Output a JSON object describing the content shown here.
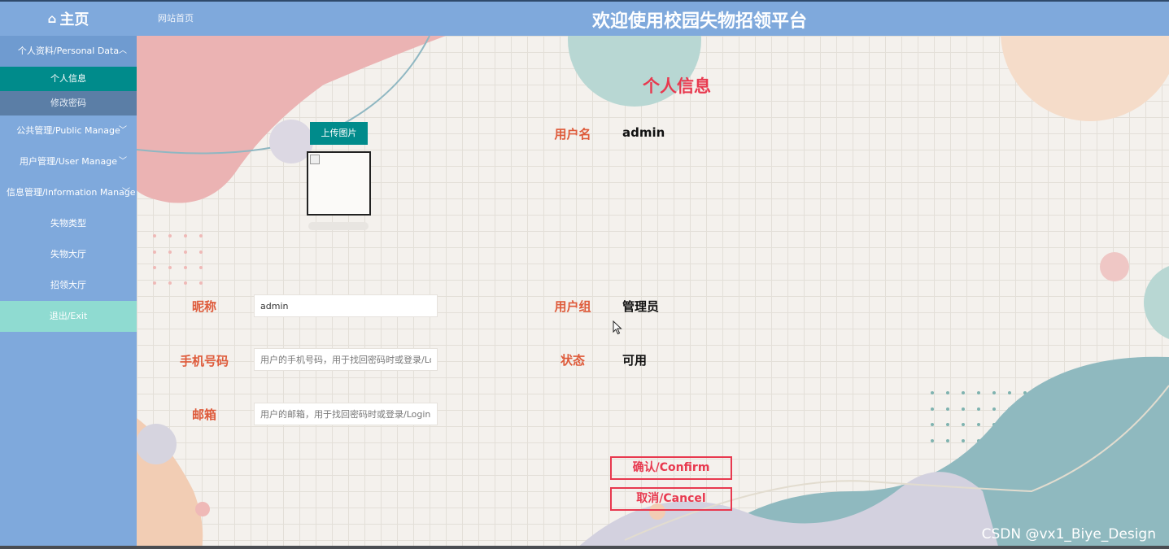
{
  "header": {
    "home_label": "主页",
    "breadcrumb": "网站首页",
    "site_title": "欢迎使用校园失物招领平台"
  },
  "sidebar": {
    "groups": [
      {
        "label": "个人资料/Personal Data",
        "expanded": true,
        "children": [
          "个人信息",
          "修改密码"
        ],
        "active_child": "个人信息"
      },
      {
        "label": "公共管理/Public Manage",
        "expanded": false
      },
      {
        "label": "用户管理/User Manage",
        "expanded": false
      },
      {
        "label": "信息管理/Information Manage",
        "expanded": false
      }
    ],
    "items": [
      "失物类型",
      "失物大厅",
      "招领大厅"
    ],
    "exit_label": "退出/Exit"
  },
  "form": {
    "page_title": "个人信息",
    "upload_label": "上传图片",
    "nickname": {
      "label": "昵称",
      "value": "admin"
    },
    "phone": {
      "label": "手机号码",
      "placeholder": "用户的手机号码，用于找回密码时或登录/Login时"
    },
    "email": {
      "label": "邮箱",
      "placeholder": "用户的邮箱，用于找回密码时或登录/Login时"
    },
    "username": {
      "label": "用户名",
      "value": "admin"
    },
    "user_group": {
      "label": "用户组",
      "value": "管理员"
    },
    "status": {
      "label": "状态",
      "value": "可用"
    },
    "confirm_label": "确认/Confirm",
    "cancel_label": "取消/Cancel"
  },
  "watermark": "CSDN @vx1_Biye_Design",
  "colors": {
    "sidebar": "#7fa9dc",
    "active": "#008b8b",
    "exit": "#8fdbd1",
    "label": "#de5a3a",
    "accent": "#e8394f"
  },
  "icons": [
    "home-icon",
    "chevron-up-icon",
    "chevron-down-icon",
    "broken-image-icon",
    "mouse-cursor-icon"
  ]
}
